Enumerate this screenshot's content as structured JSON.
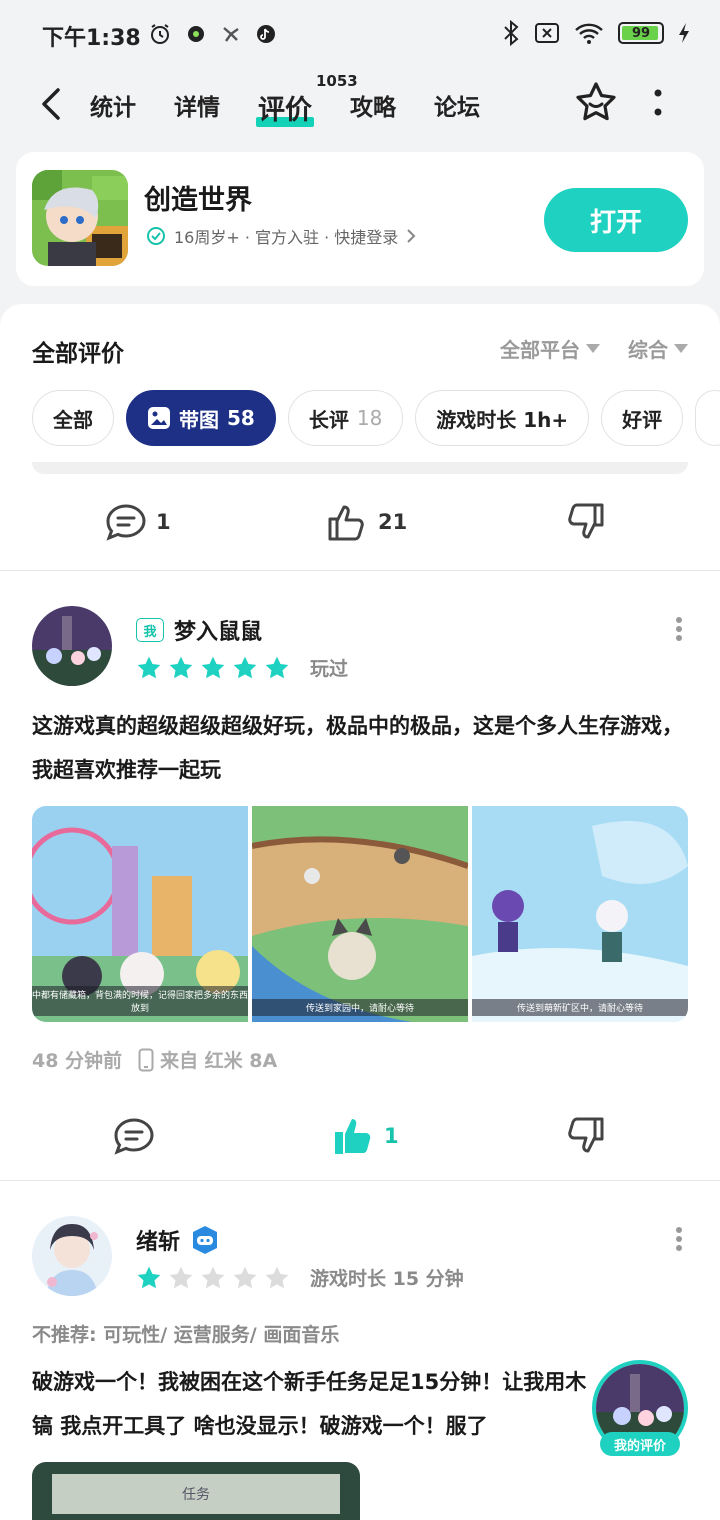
{
  "status_bar": {
    "time": "下午1:38",
    "battery": "99"
  },
  "nav": {
    "tabs": [
      {
        "label": "统计"
      },
      {
        "label": "详情"
      },
      {
        "label": "评价",
        "active": true
      },
      {
        "label": "攻略"
      },
      {
        "label": "论坛"
      }
    ],
    "review_count": "1053"
  },
  "game": {
    "name": "创造世界",
    "meta": "16周岁+ · 官方入驻 · 快捷登录",
    "open_label": "打开"
  },
  "reviews_panel": {
    "title": "全部评价",
    "filter_platform": "全部平台",
    "filter_sort": "综合",
    "chips": [
      {
        "label": "全部",
        "count": ""
      },
      {
        "label": "带图",
        "count": "58",
        "active": true
      },
      {
        "label": "长评",
        "count": "18"
      },
      {
        "label": "游戏时长 1h+",
        "count": ""
      },
      {
        "label": "好评",
        "count": ""
      }
    ]
  },
  "prev_review_actions": {
    "comments": "1",
    "likes": "21"
  },
  "review_1": {
    "badge": "我",
    "user": "梦入鼠鼠",
    "rating": 5,
    "tag": "玩过",
    "text": "这游戏真的超级超级超级好玩，极品中的极品，这是个多人生存游戏，我超喜欢推荐一起玩",
    "images": [
      {
        "caption": "中都有储藏箱，背包满的时候，记得回家把多余的东西放到"
      },
      {
        "caption": "传送到家园中，请耐心等待"
      },
      {
        "caption": "传送到萌新矿区中，请耐心等待"
      }
    ],
    "time": "48 分钟前",
    "device": "来自 红米 8A",
    "likes": "1"
  },
  "review_2": {
    "user": "绪斩",
    "rating": 1,
    "tag": "游戏时长 15 分钟",
    "not_recommend": "不推荐: 可玩性/ 运营服务/ 画面音乐",
    "text": "破游戏一个！我被困在这个新手任务足足15分钟！让我用木镐 我点开工具了 啥也没显示！破游戏一个！服了",
    "image_caption": "任务"
  },
  "fab": {
    "label": "我的评价"
  },
  "colors": {
    "accent": "#1ed1c0",
    "chip_active": "#1e2f86"
  }
}
